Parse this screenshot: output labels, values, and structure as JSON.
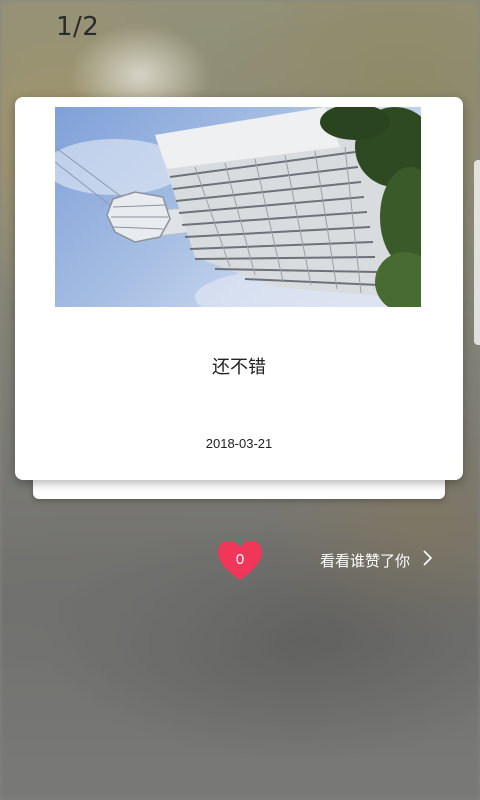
{
  "header": {
    "page_indicator": "1/2"
  },
  "card": {
    "photo_icon": "building-photo",
    "caption": "还不错",
    "date": "2018-03-21"
  },
  "actions": {
    "like_count": "0",
    "like_icon": "heart-icon",
    "like_color": "#f0375a",
    "who_liked_label": "看看谁赞了你",
    "chevron_icon": "chevron-right-icon"
  }
}
